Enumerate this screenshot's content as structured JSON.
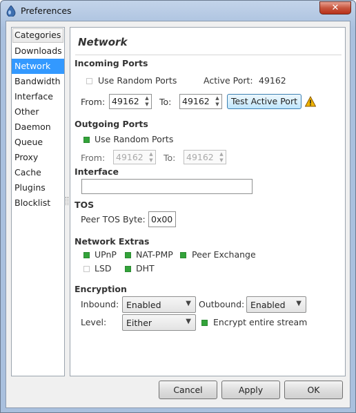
{
  "window": {
    "title": "Preferences",
    "close_symbol": "✕"
  },
  "sidebar": {
    "header": "Categories",
    "items": [
      {
        "label": "Downloads",
        "selected": false
      },
      {
        "label": "Network",
        "selected": true
      },
      {
        "label": "Bandwidth",
        "selected": false
      },
      {
        "label": "Interface",
        "selected": false
      },
      {
        "label": "Other",
        "selected": false
      },
      {
        "label": "Daemon",
        "selected": false
      },
      {
        "label": "Queue",
        "selected": false
      },
      {
        "label": "Proxy",
        "selected": false
      },
      {
        "label": "Cache",
        "selected": false
      },
      {
        "label": "Plugins",
        "selected": false
      },
      {
        "label": "Blocklist",
        "selected": false
      }
    ]
  },
  "network": {
    "heading": "Network",
    "incoming": {
      "title": "Incoming Ports",
      "random_label": "Use Random Ports",
      "random_checked": false,
      "active_port_label": "Active Port:",
      "active_port": "49162",
      "from_label": "From:",
      "from_value": "49162",
      "to_label": "To:",
      "to_value": "49162",
      "test_button": "Test Active Port"
    },
    "outgoing": {
      "title": "Outgoing Ports",
      "random_label": "Use Random Ports",
      "random_checked": true,
      "from_label": "From:",
      "from_value": "49162",
      "to_label": "To:",
      "to_value": "49162"
    },
    "interface": {
      "title": "Interface",
      "value": ""
    },
    "tos": {
      "title": "TOS",
      "label": "Peer TOS Byte:",
      "value": "0x00"
    },
    "extras": {
      "title": "Network Extras",
      "upnp": {
        "label": "UPnP",
        "checked": true
      },
      "natpmp": {
        "label": "NAT-PMP",
        "checked": true
      },
      "pex": {
        "label": "Peer Exchange",
        "checked": true
      },
      "lsd": {
        "label": "LSD",
        "checked": false
      },
      "dht": {
        "label": "DHT",
        "checked": true
      }
    },
    "encryption": {
      "title": "Encryption",
      "inbound_label": "Inbound:",
      "inbound_value": "Enabled",
      "outbound_label": "Outbound:",
      "outbound_value": "Enabled",
      "level_label": "Level:",
      "level_value": "Either",
      "encrypt_stream_label": "Encrypt entire stream",
      "encrypt_stream_checked": true
    }
  },
  "footer": {
    "cancel": "Cancel",
    "apply": "Apply",
    "ok": "OK"
  },
  "colors": {
    "selection": "#3399ff",
    "check_on": "#33a33a",
    "warning": "#f0b400"
  }
}
